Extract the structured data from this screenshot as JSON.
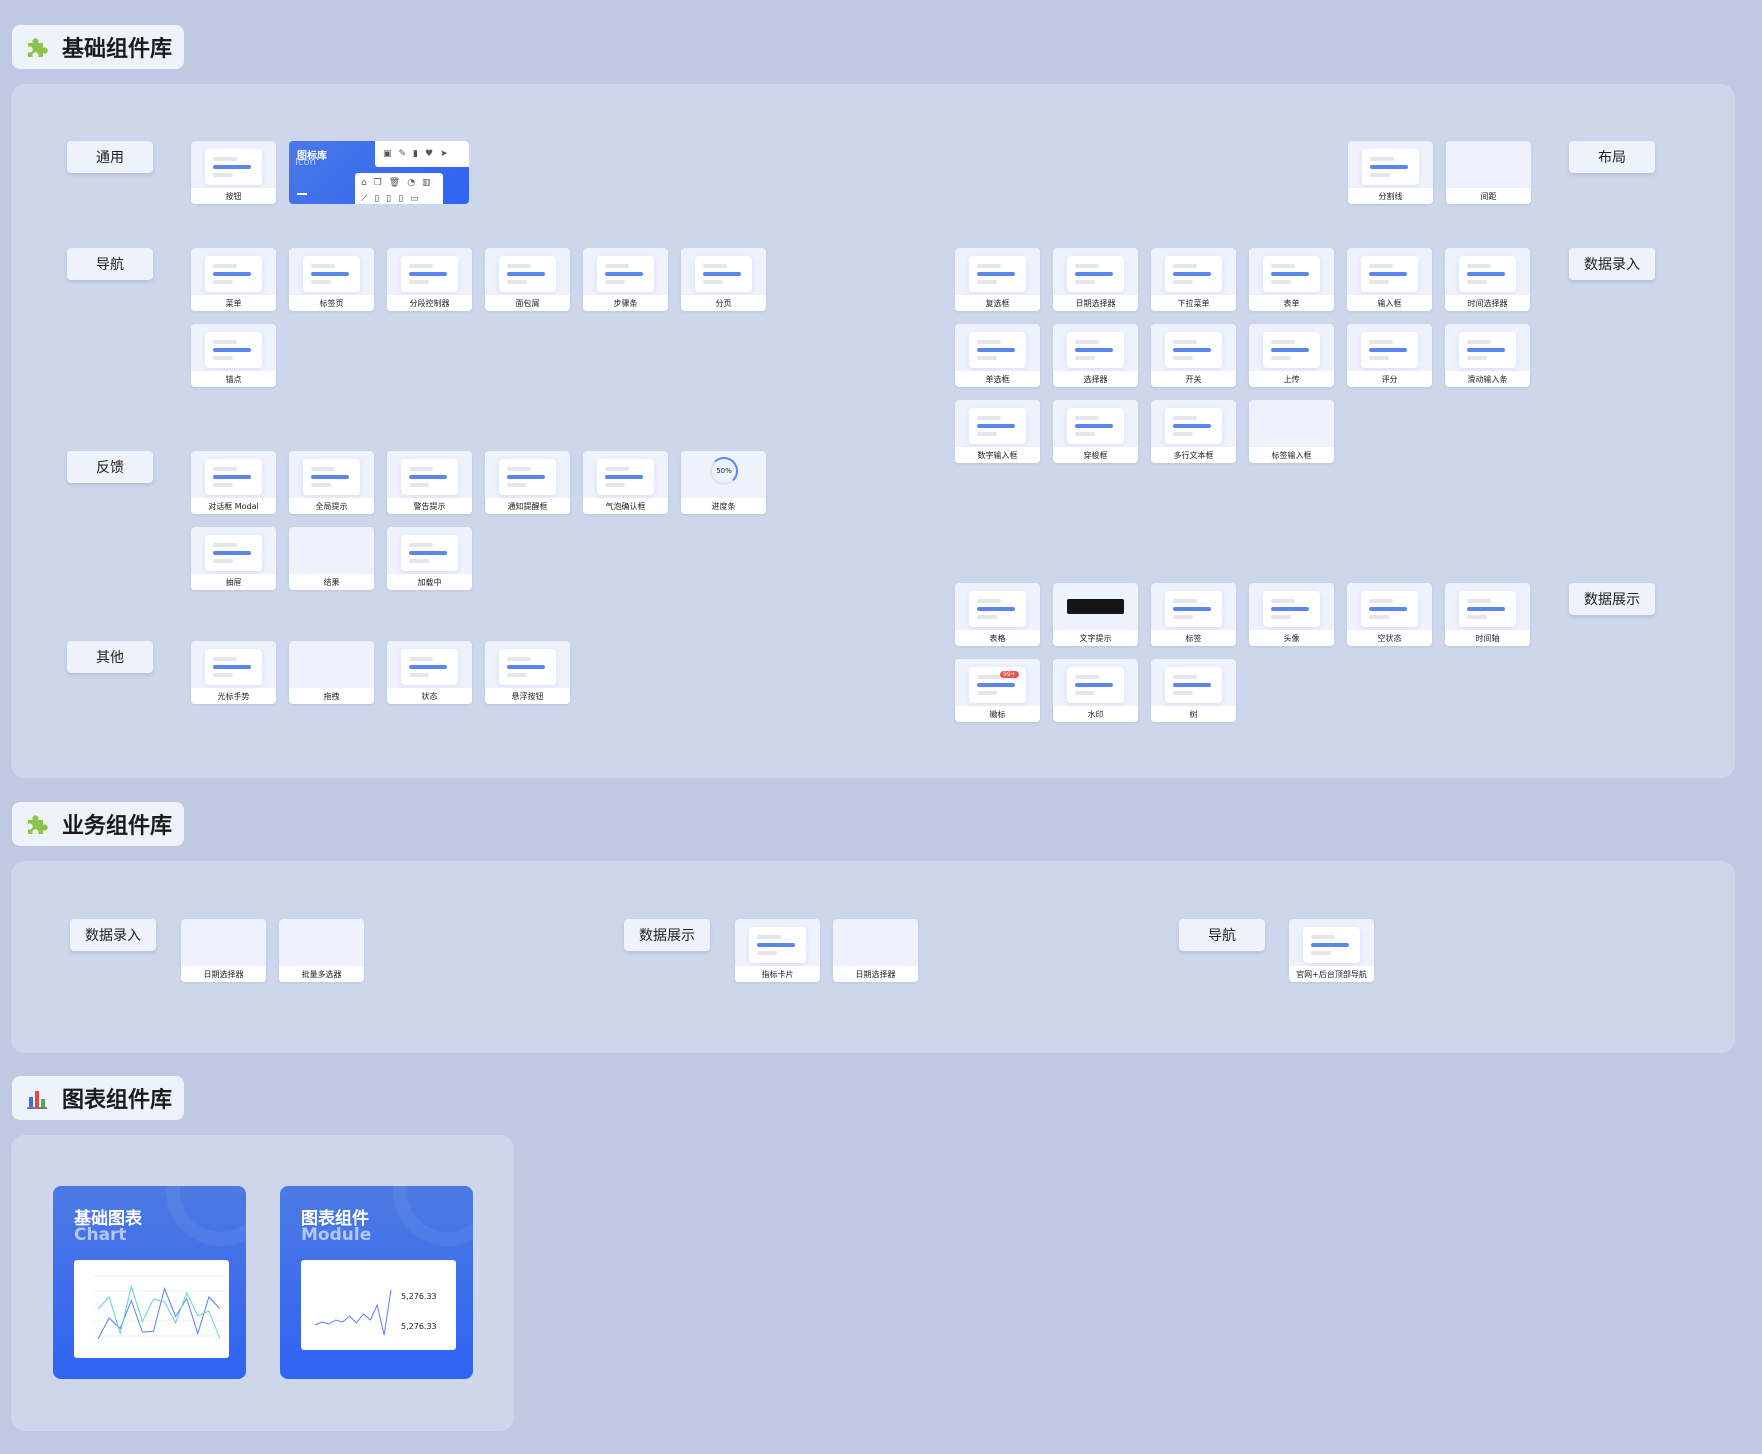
{
  "sections": {
    "basic": {
      "title": "基础组件库"
    },
    "business": {
      "title": "业务组件库"
    },
    "charts": {
      "title": "图表组件库"
    }
  },
  "basic": {
    "categories": {
      "general": "通用",
      "nav": "导航",
      "feedback": "反馈",
      "other": "其他",
      "layout": "布局",
      "entry": "数据录入",
      "display": "数据展示"
    },
    "general": [
      "按钮"
    ],
    "icon_library": {
      "title": "图标库",
      "subtitle": "Icon",
      "icons_top": "▣✎▮♥➤",
      "icons_bottom": "⌂❐🗑◔▥ ⟋▯▯▯▭"
    },
    "nav": [
      "菜单",
      "标签页",
      "分段控制器",
      "面包屑",
      "步骤条",
      "分页",
      "锚点"
    ],
    "feedback": [
      "对话框 Modal",
      "全局提示",
      "警告提示",
      "通知提醒框",
      "气泡确认框",
      "进度条",
      "抽屉",
      "结果",
      "加载中"
    ],
    "progress_value": "50%",
    "other": [
      "光标手势",
      "拖拽",
      "状态",
      "悬浮按钮"
    ],
    "layout": [
      "分割线",
      "间距"
    ],
    "entry": [
      "复选框",
      "日期选择器",
      "下拉菜单",
      "表单",
      "输入框",
      "时间选择器",
      "单选框",
      "选择器",
      "开关",
      "上传",
      "评分",
      "滑动输入条",
      "数字输入框",
      "穿梭框",
      "多行文本框",
      "标签输入框"
    ],
    "display": [
      "表格",
      "文字提示",
      "标签",
      "头像",
      "空状态",
      "时间轴",
      "徽标",
      "水印",
      "树"
    ],
    "badge_count": "99+"
  },
  "business": {
    "groups": [
      {
        "label": "数据录入",
        "cards": [
          "日期选择器",
          "批量多选器"
        ]
      },
      {
        "label": "数据展示",
        "cards": [
          "指标卡片",
          "日期选择器"
        ]
      },
      {
        "label": "导航",
        "cards": [
          "官网+后台顶部导航"
        ]
      }
    ]
  },
  "charts": {
    "cards": [
      {
        "title": "基础图表",
        "subtitle": "Chart"
      },
      {
        "title": "图表组件",
        "subtitle": "Module",
        "metric1": "5,276.33",
        "metric2": "5,276.33"
      }
    ],
    "thumb_series": {
      "a": [
        100,
        400,
        250,
        650,
        200,
        210,
        820,
        420,
        680,
        180,
        700,
        530
      ],
      "b": [
        530,
        700,
        180,
        850,
        350,
        670,
        630,
        330,
        760,
        430,
        500,
        100
      ],
      "c": [
        30,
        36,
        32,
        40,
        36,
        48,
        34,
        52,
        40,
        70,
        10,
        100
      ]
    }
  }
}
